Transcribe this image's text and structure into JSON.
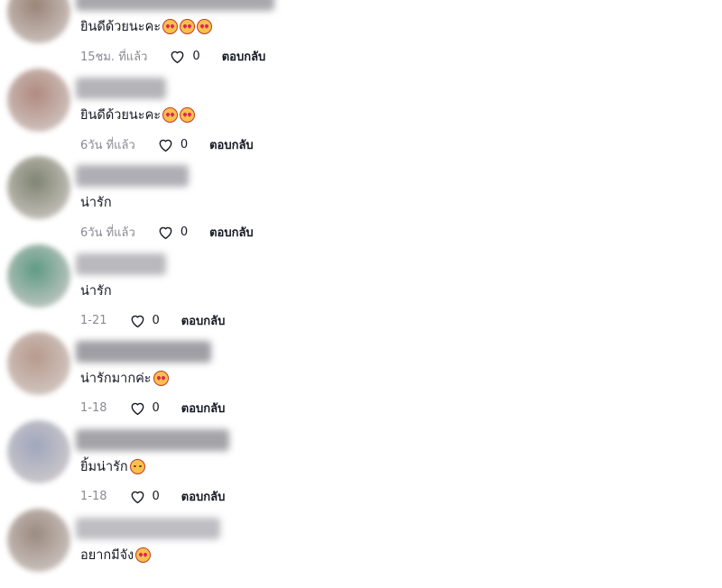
{
  "comments": [
    {
      "text": "ยินดีด้วยนะคะ",
      "emojis": 3,
      "time": "15ชม. ที่แล้ว",
      "likes": "0",
      "reply": "ตอบกลับ",
      "avatar_color": "#9a8478",
      "name_color": "#a8a8ad"
    },
    {
      "text": "ยินดีด้วยนะคะ",
      "emojis": 2,
      "time": "6วัน ที่แล้ว",
      "likes": "0",
      "reply": "ตอบกลับ",
      "avatar_color": "#b08a80",
      "name_color": "#b3b3b8"
    },
    {
      "text": "น่ารัก",
      "emojis": 0,
      "time": "6วัน ที่แล้ว",
      "likes": "0",
      "reply": "ตอบกลับ",
      "avatar_color": "#7f8471",
      "name_color": "#aeaeb4"
    },
    {
      "text": "น่ารัก",
      "emojis": 0,
      "time": "1-21",
      "likes": "0",
      "reply": "ตอบกลับ",
      "avatar_color": "#5f9a86",
      "name_color": "#b8b8bd"
    },
    {
      "text": "น่ารักมากค่ะ",
      "emojis": 1,
      "time": "1-18",
      "likes": "0",
      "reply": "ตอบกลับ",
      "avatar_color": "#b79a8d",
      "name_color": "#9e9ea4"
    },
    {
      "text": "ยิ้มน่ารัก",
      "emojis": 1,
      "smile": true,
      "time": "1-18",
      "likes": "0",
      "reply": "ตอบกลับ",
      "avatar_color": "#a0a6bd",
      "name_color": "#a3a3a8"
    },
    {
      "text": "อยากมีจัง",
      "emojis": 1,
      "time": "",
      "likes": "",
      "reply": "",
      "avatar_color": "#9b8a80",
      "name_color": "#bdbdc2"
    }
  ]
}
